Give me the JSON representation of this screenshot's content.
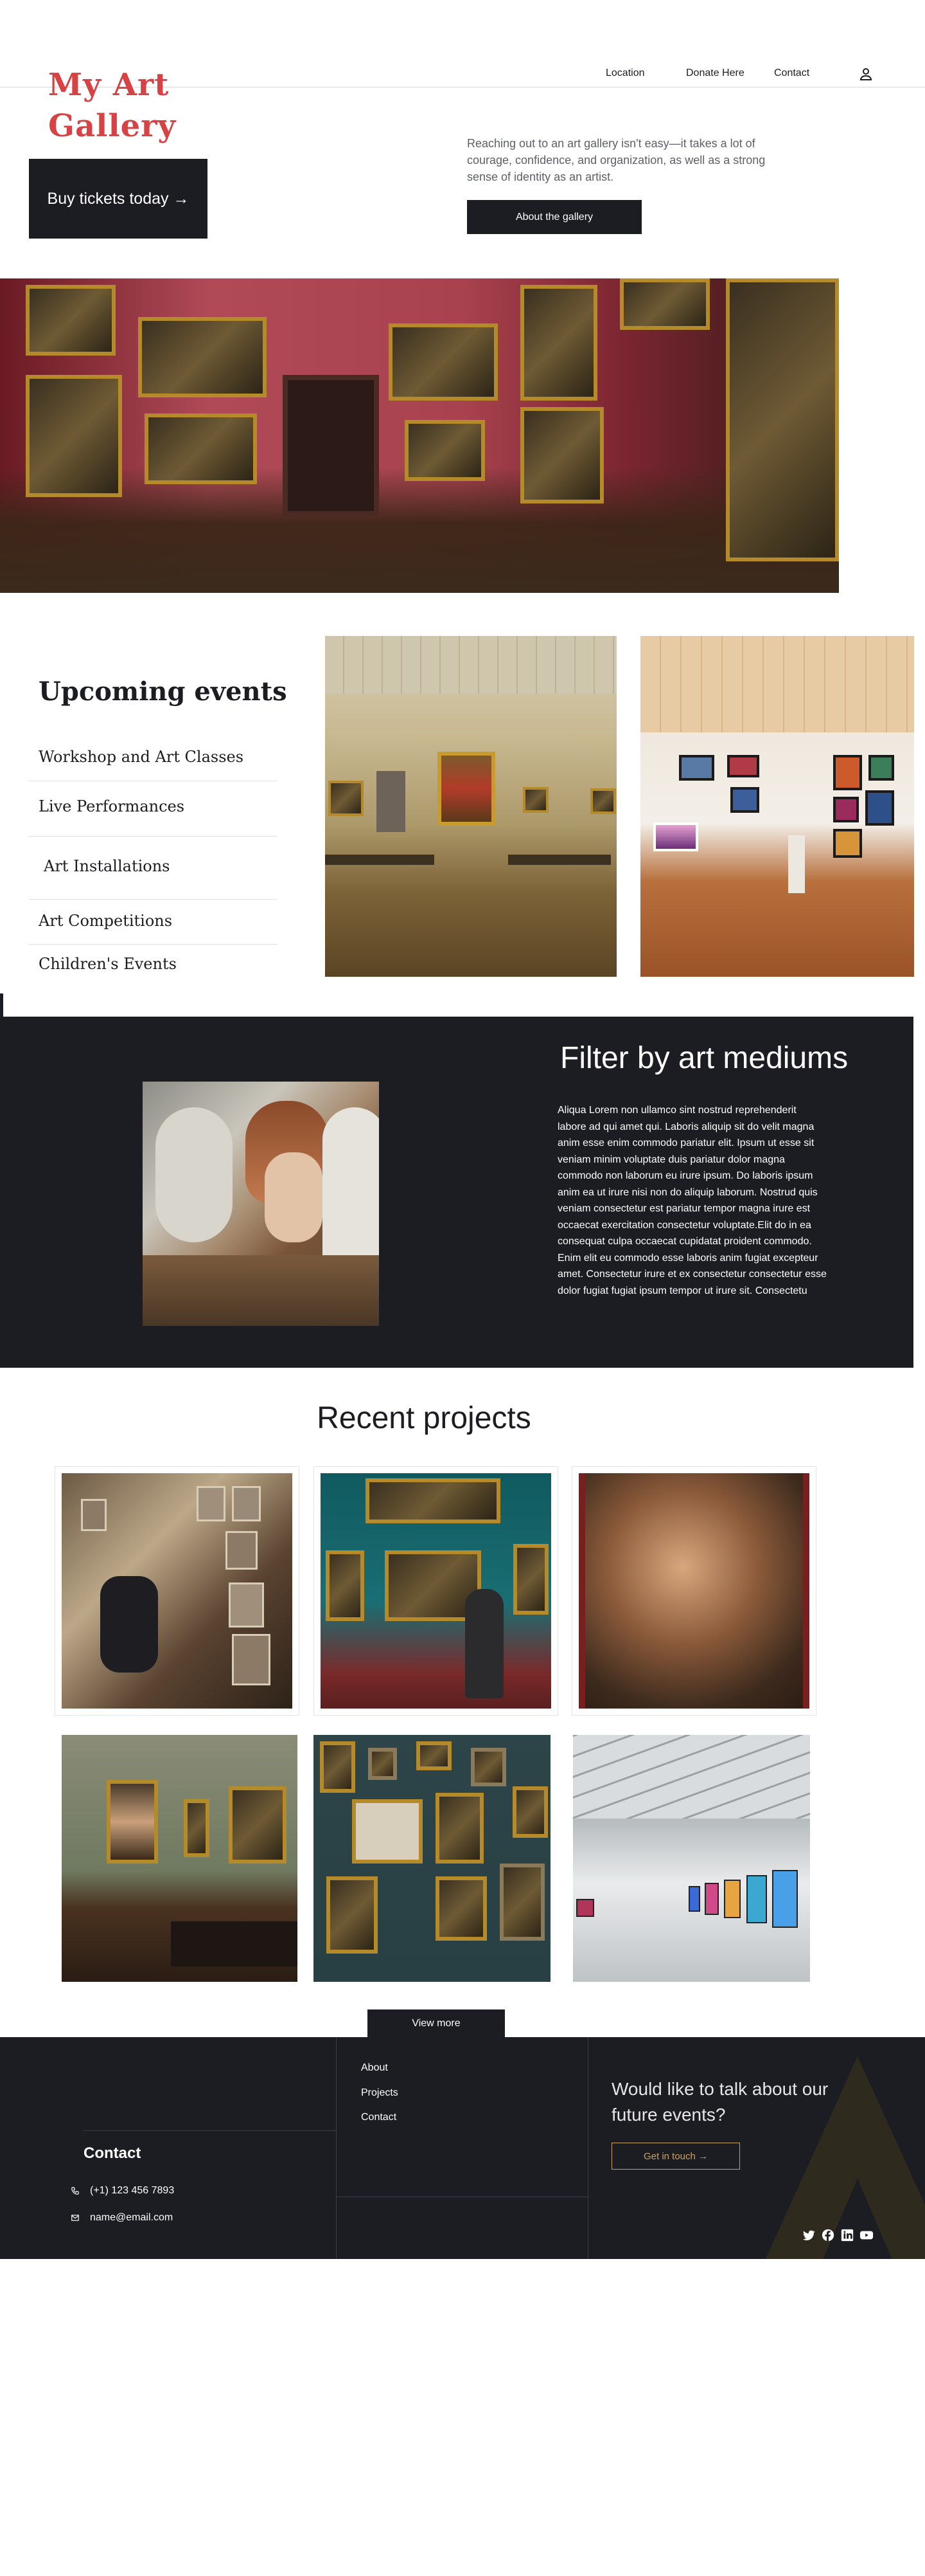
{
  "header": {
    "logo_line1": "My Art",
    "logo_line2": "Gallery",
    "nav": [
      "Location",
      "Donate Here",
      "Contact"
    ],
    "user_icon": "user-icon"
  },
  "hero": {
    "cta_label": "Buy tickets today →",
    "intro": "Reaching out to an art gallery isn't easy—it takes a lot of courage, confidence, and organization, as well as a strong sense of identity as an artist.",
    "about_label": "About the gallery"
  },
  "events": {
    "title": "Upcoming events",
    "items": [
      "Workshop and Art Classes",
      "Live Performances",
      "Art Installations",
      "Art Competitions",
      "Children's Events"
    ]
  },
  "filter": {
    "title": "Filter by art mediums",
    "body": "Aliqua Lorem non ullamco sint nostrud reprehenderit labore ad qui amet qui. Laboris aliquip sit do velit magna anim esse enim commodo pariatur elit. Ipsum ut esse sit veniam minim voluptate duis pariatur dolor magna commodo non laborum eu irure ipsum. Do laboris ipsum anim ea ut irure nisi non do aliquip laborum. Nostrud quis veniam consectetur est pariatur tempor magna irure est occaecat exercitation consectetur voluptate.Elit do in ea consequat culpa occaecat cupidatat proident commodo. Enim elit eu commodo esse laboris anim fugiat excepteur amet. Consectetur irure et ex consectetur consectetur esse dolor fugiat fugiat ipsum tempor ut irure sit. Consectetu"
  },
  "projects": {
    "title": "Recent projects",
    "more_label": "View more"
  },
  "footer": {
    "links": [
      "About",
      "Projects",
      "Contact"
    ],
    "contact_title": "Contact",
    "phone": "(+1) 123 456 7893",
    "email": "name@email.com",
    "cta": "Would like to talk about our future events?",
    "touch_label": "Get in touch →",
    "social": [
      "twitter-icon",
      "facebook-icon",
      "linkedin-icon",
      "youtube-icon"
    ]
  },
  "colors": {
    "brand": "#d74344",
    "dark": "#1b1d22",
    "accent": "#c9a15a"
  }
}
